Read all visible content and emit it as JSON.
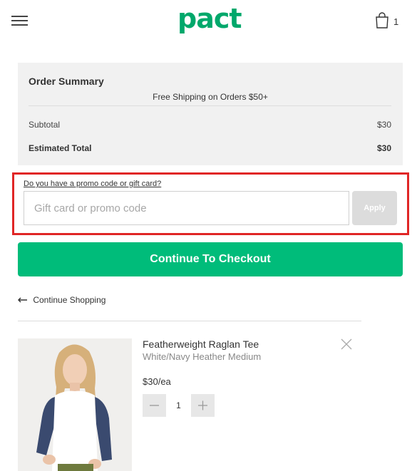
{
  "header": {
    "logo": "pact",
    "cart_count": "1",
    "brand_color": "#00a86b"
  },
  "summary": {
    "title": "Order Summary",
    "free_shipping": "Free Shipping on Orders $50+",
    "subtotal_label": "Subtotal",
    "subtotal_value": "$30",
    "total_label": "Estimated Total",
    "total_value": "$30"
  },
  "promo": {
    "link_text": "Do you have a promo code or gift card?",
    "input_placeholder": "Gift card or promo code",
    "input_value": "",
    "apply_label": "Apply",
    "highlight_color": "#e02626"
  },
  "checkout": {
    "button_label": "Continue To Checkout",
    "button_color": "#00bc7a"
  },
  "continue_shopping": {
    "label": "Continue Shopping"
  },
  "cart_item": {
    "name": "Featherweight Raglan Tee",
    "variant": "White/Navy Heather Medium",
    "price": "$30",
    "price_unit": "/ea",
    "quantity": "1"
  }
}
